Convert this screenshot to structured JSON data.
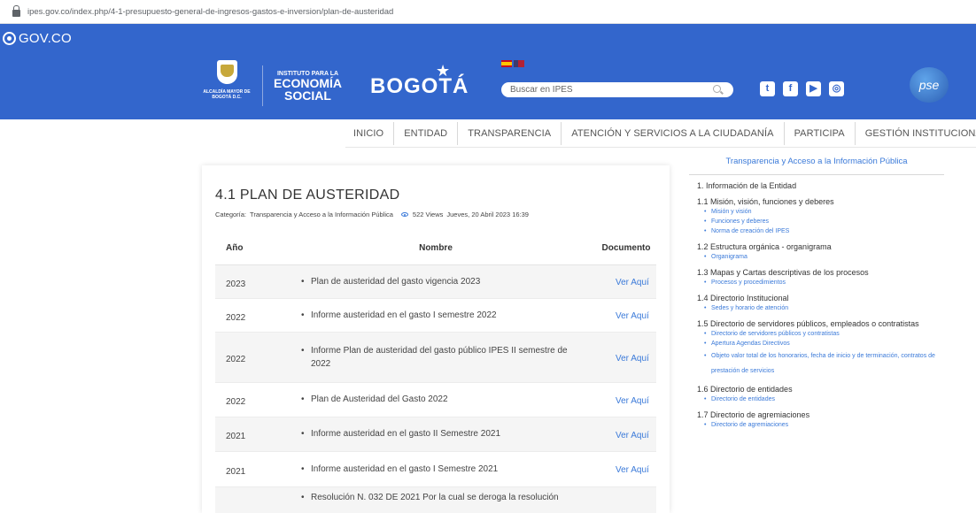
{
  "browser": {
    "url": "ipes.gov.co/index.php/4-1-presupuesto-general-de-ingresos-gastos-e-inversion/plan-de-austeridad"
  },
  "govbar": {
    "label": "GOV.CO"
  },
  "header": {
    "alcaldia": "ALCALDÍA MAYOR DE BOGOTÁ D.C.",
    "logo_line1": "INSTITUTO PARA LA",
    "logo_line2": "ECONOMÍA",
    "logo_line3": "SOCIAL",
    "bogota": "BOGOTÁ",
    "search_placeholder": "Buscar en IPES",
    "pse": "pse",
    "social_icons": [
      "twitter-icon",
      "facebook-icon",
      "youtube-icon",
      "instagram-icon"
    ]
  },
  "nav": {
    "items": [
      "INICIO",
      "ENTIDAD",
      "TRANSPARENCIA",
      "ATENCIÓN Y SERVICIOS A LA CIUDADANÍA",
      "PARTICIPA",
      "GESTIÓN INSTITUCIONAL"
    ]
  },
  "article": {
    "title": "4.1 PLAN DE AUSTERIDAD",
    "category_label": "Categoría:",
    "category": "Transparencia y Acceso a la Información Pública",
    "views": "522 Views",
    "date": "Jueves, 20 Abril 2023 16:39",
    "table": {
      "headers": [
        "Año",
        "Nombre",
        "Documento"
      ],
      "rows": [
        {
          "year": "2023",
          "name": "Plan de austeridad del gasto vigencia 2023",
          "doc": "Ver Aquí"
        },
        {
          "year": "2022",
          "name": "Informe austeridad en el gasto I semestre 2022",
          "doc": "Ver Aquí"
        },
        {
          "year": "2022",
          "name": "Informe Plan de austeridad del gasto público IPES II semestre de 2022",
          "doc": "Ver Aquí"
        },
        {
          "year": "2022",
          "name": "Plan de Austeridad del Gasto 2022",
          "doc": "Ver Aquí"
        },
        {
          "year": "2021",
          "name": "Informe austeridad en el gasto II Semestre 2021",
          "doc": "Ver Aquí"
        },
        {
          "year": "2021",
          "name": "Informe austeridad en el gasto I Semestre 2021",
          "doc": "Ver Aquí"
        },
        {
          "year": "",
          "name": "Resolución N. 032 DE 2021 Por la cual se deroga la resolución",
          "doc": ""
        }
      ]
    }
  },
  "sidebar": {
    "title": "Transparencia y Acceso a la Información Pública",
    "sections": [
      {
        "label": "1. Información de la Entidad",
        "subs": []
      },
      {
        "label": "1.1 Misión, visión, funciones y deberes",
        "subs": [
          "Misión y visión",
          "Funciones y deberes",
          "Norma de creación del IPES"
        ]
      },
      {
        "label": "1.2 Estructura orgánica - organigrama",
        "subs": [
          "Organigrama"
        ]
      },
      {
        "label": "1.3 Mapas y Cartas descriptivas de los procesos",
        "subs": [
          "Procesos y procedimientos"
        ]
      },
      {
        "label": "1.4 Directorio Institucional",
        "subs": [
          "Sedes y horario de atención"
        ]
      },
      {
        "label": "1.5 Directorio de servidores públicos, empleados o contratistas",
        "subs": [
          "Directorio de servidores públicos y contratistas",
          "Apertura Agendas Directivos",
          "Objeto valor total de los honorarios, fecha de inicio y de terminación, contratos de prestación de servicios"
        ]
      },
      {
        "label": "1.6 Directorio de entidades",
        "subs": [
          "Directorio de entidades"
        ]
      },
      {
        "label": "1.7 Directorio de agremiaciones",
        "subs": [
          "Directorio de agremiaciones"
        ]
      }
    ]
  }
}
